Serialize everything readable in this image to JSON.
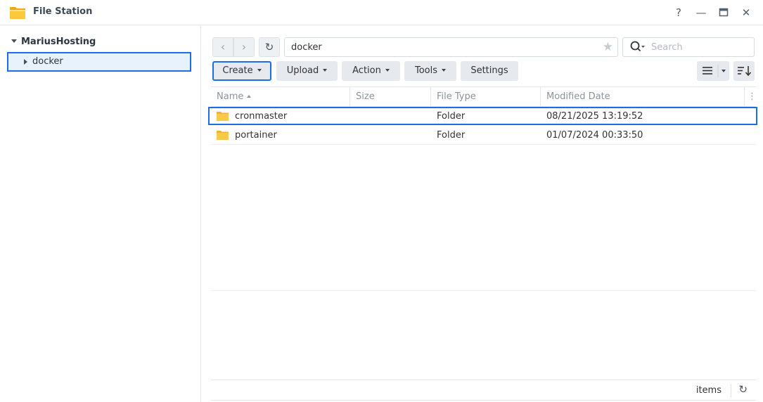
{
  "window": {
    "title": "File Station",
    "help": "?",
    "minimize": "—",
    "maximize": "▭",
    "close": "✕"
  },
  "sidebar": {
    "root": "MariusHosting",
    "items": [
      {
        "label": "docker",
        "selected": true
      }
    ]
  },
  "toolbar": {
    "back": "‹",
    "forward": "›",
    "refresh": "↻",
    "path": "docker",
    "favorite": "★",
    "search_placeholder": "Search",
    "buttons": {
      "create": "Create",
      "upload": "Upload",
      "action": "Action",
      "tools": "Tools",
      "settings": "Settings"
    }
  },
  "list": {
    "columns": {
      "name": "Name",
      "size": "Size",
      "type": "File Type",
      "modified": "Modified Date",
      "more": "⋮"
    },
    "rows": [
      {
        "name": "cronmaster",
        "size": "",
        "type": "Folder",
        "modified": "08/21/2025 13:19:52",
        "highlighted": true
      },
      {
        "name": "portainer",
        "size": "",
        "type": "Folder",
        "modified": "01/07/2024 00:33:50",
        "highlighted": false
      }
    ]
  },
  "footer": {
    "items_label": "items",
    "refresh": "↻"
  },
  "colors": {
    "accent": "#1a6fe6",
    "folder": "#f5c242",
    "selected_bg": "#e8f2fd"
  }
}
